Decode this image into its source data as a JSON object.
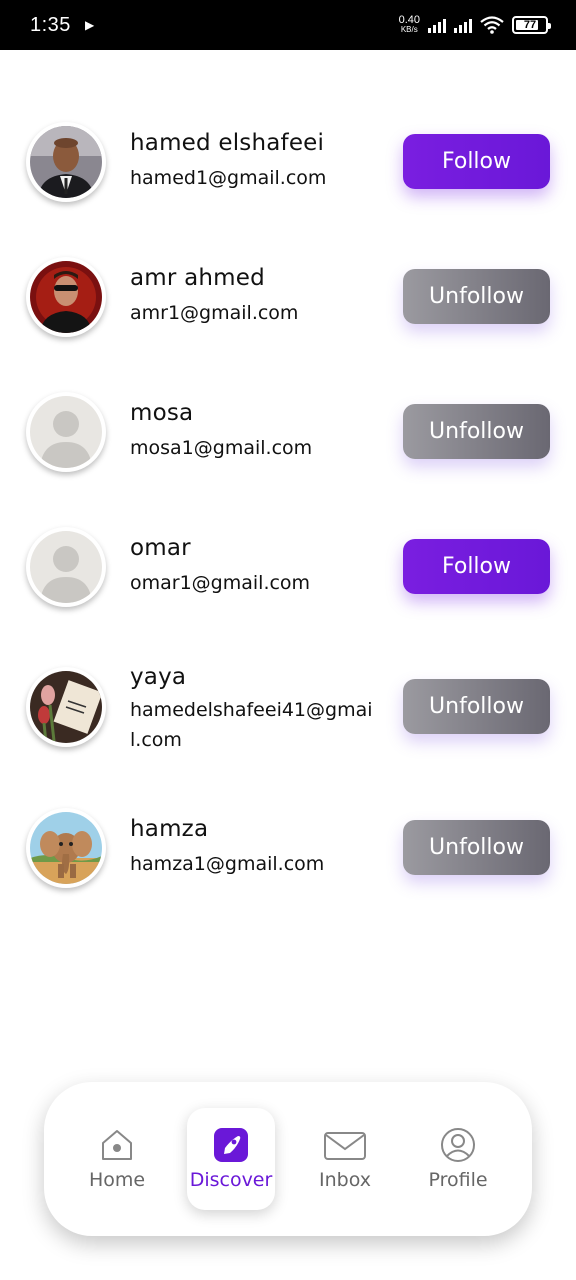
{
  "status_bar": {
    "time": "1:35",
    "net_speed_value": "0.40",
    "net_speed_unit": "KB/s",
    "battery": "77",
    "battery_level": 0.77
  },
  "users": [
    {
      "name": "hamed elshafeei",
      "email": "hamed1@gmail.com",
      "button": "Follow",
      "following": false,
      "avatar": "photo-man-suit"
    },
    {
      "name": "amr ahmed",
      "email": "amr1@gmail.com",
      "button": "Unfollow",
      "following": true,
      "avatar": "photo-man-sunglasses"
    },
    {
      "name": "mosa",
      "email": "mosa1@gmail.com",
      "button": "Unfollow",
      "following": true,
      "avatar": "default-avatar"
    },
    {
      "name": "omar",
      "email": "omar1@gmail.com",
      "button": "Follow",
      "following": false,
      "avatar": "default-avatar"
    },
    {
      "name": "yaya",
      "email": "hamedelshafeei41@gmail.com",
      "button": "Unfollow",
      "following": true,
      "avatar": "photo-tulips-card"
    },
    {
      "name": "hamza",
      "email": "hamza1@gmail.com",
      "button": "Unfollow",
      "following": true,
      "avatar": "photo-cartoon-elephant"
    }
  ],
  "nav": {
    "home": "Home",
    "discover": "Discover",
    "inbox": "Inbox",
    "profile": "Profile",
    "active": "discover"
  },
  "colors": {
    "accent": "#6a18d8",
    "follow_button": "#7a1ee0",
    "unfollow_button": "#7d7c84"
  }
}
